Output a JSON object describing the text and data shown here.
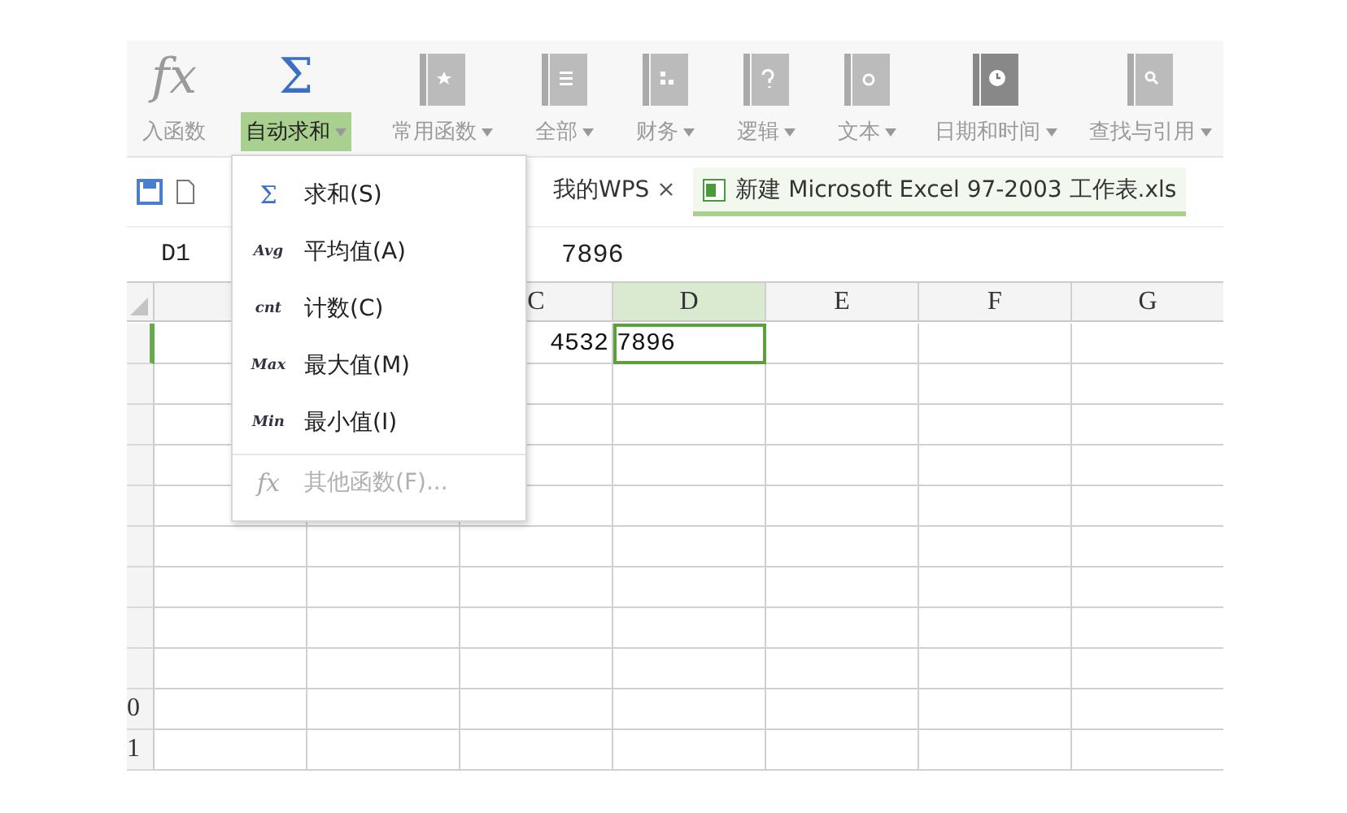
{
  "toolbar": {
    "items": [
      {
        "kind": "fx",
        "symbol": "fx",
        "label": "入函数",
        "selected": false,
        "dropdown": false
      },
      {
        "kind": "sum",
        "symbol": "Σ",
        "label": "自动求和",
        "selected": true,
        "dropdown": true
      },
      {
        "kind": "star",
        "label": "常用函数",
        "selected": false,
        "dropdown": true
      },
      {
        "kind": "list",
        "label": "全部",
        "selected": false,
        "dropdown": true
      },
      {
        "kind": "chart",
        "label": "财务",
        "selected": false,
        "dropdown": true
      },
      {
        "kind": "question",
        "label": "逻辑",
        "selected": false,
        "dropdown": true
      },
      {
        "kind": "text",
        "label": "文本",
        "selected": false,
        "dropdown": true
      },
      {
        "kind": "clock",
        "label": "日期和时间",
        "selected": false,
        "dropdown": true
      },
      {
        "kind": "search",
        "label": "查找与引用",
        "selected": false,
        "dropdown": true
      }
    ]
  },
  "tabs": [
    {
      "label": "我的WPS",
      "selected": false,
      "closable": true
    },
    {
      "label": "新建 Microsoft Excel 97-2003 工作表.xls",
      "selected": true,
      "closable": false
    }
  ],
  "formula_bar": {
    "name_box": "D1",
    "value": "7896"
  },
  "sheet": {
    "columns": [
      {},
      {},
      {
        "label": "C",
        "selected": false
      },
      {
        "label": "D",
        "selected": true
      },
      {
        "label": "E",
        "selected": false
      },
      {
        "label": "F",
        "selected": false
      },
      {
        "label": "G",
        "selected": false
      }
    ],
    "rows": [
      {
        "selected": true,
        "cells": [
          {},
          {},
          {
            "text": "4532"
          },
          {
            "text": "7896"
          },
          {},
          {},
          {}
        ]
      },
      {
        "selected": false
      },
      {
        "selected": false
      },
      {
        "selected": false
      },
      {
        "selected": false
      },
      {
        "selected": false
      },
      {
        "selected": false
      },
      {
        "selected": false
      },
      {
        "selected": false
      },
      {
        "selected": false,
        "number": "0"
      },
      {
        "selected": false,
        "number": "1"
      }
    ]
  },
  "menu": {
    "items": [
      {
        "symbol": "Σ",
        "label": "求和(S)",
        "disabled": false,
        "kind": "sigma"
      },
      {
        "symbol": "Avg",
        "label": "平均值(A)",
        "disabled": false,
        "kind": "code"
      },
      {
        "symbol": "cnt",
        "label": "计数(C)",
        "disabled": false,
        "kind": "code"
      },
      {
        "symbol": "Max",
        "label": "最大值(M)",
        "disabled": false,
        "kind": "code"
      },
      {
        "symbol": "Min",
        "label": "最小值(I)",
        "disabled": false,
        "kind": "code"
      },
      {
        "symbol": "fx",
        "label": "其他函数(F)...",
        "disabled": true,
        "kind": "fx",
        "separated": true
      }
    ]
  }
}
